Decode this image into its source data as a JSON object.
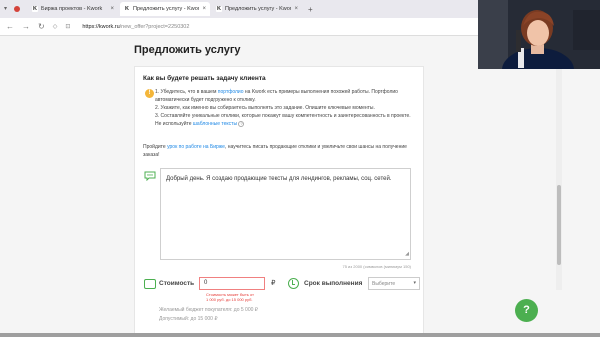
{
  "browser": {
    "tabs": [
      {
        "title": "Биржа проектов - Kwork",
        "active": false
      },
      {
        "title": "Предложить услугу - Kwork",
        "active": true
      },
      {
        "title": "Предложить услугу - Kwork",
        "active": false
      }
    ],
    "url_host": "https://kwork.ru",
    "url_rest": "/new_offer?project=2250302"
  },
  "page": {
    "title": "Предложить услугу"
  },
  "card": {
    "section_title": "Как вы будете решать задачу клиента",
    "tip1_before": "1. Убедитесь, что в вашем ",
    "tip1_link": "портфолио",
    "tip1_after": " на Kwork есть примеры выполнения похожей работы. Портфолио автоматически будет подгружено к отклику.",
    "tip2": "2. Укажите, как именно вы собираетесь выполнять это задание. Опишите ключевые моменты.",
    "tip3_before": "3. Составляйте уникальные отклики, которые покажут вашу компетентность и заинтересованность в проекте. Не используйте ",
    "tip3_link": "шаблонные тексты",
    "lesson_before": "Пройдите ",
    "lesson_link": "урок по работе на Бирже",
    "lesson_after": ", научитесь писать продающие отклики и увеличьте свои шансы на получение заказа!",
    "message_text": "Добрый день. Я создаю продающие тексты для лендингов, рекламы, соц. сетей.",
    "counter": "75 из 2000 (символов (минимум 150)",
    "cost_label": "Стоимость",
    "cost_value": "0",
    "currency": "₽",
    "cost_error_1": "Стоимость может быть от",
    "cost_error_2": "1 000 руб. до 15 000 руб.",
    "time_label": "Срок выполнения",
    "time_placeholder": "Выберите",
    "budget_desired": "Желаемый бюджет покупателя: до 5 000 ₽",
    "budget_allowed": "Допустимый: до 15 000 ₽"
  },
  "help_button": "?",
  "colors": {
    "accent_green": "#4caf50",
    "link_blue": "#1e88e5",
    "error_red": "#e53935"
  }
}
